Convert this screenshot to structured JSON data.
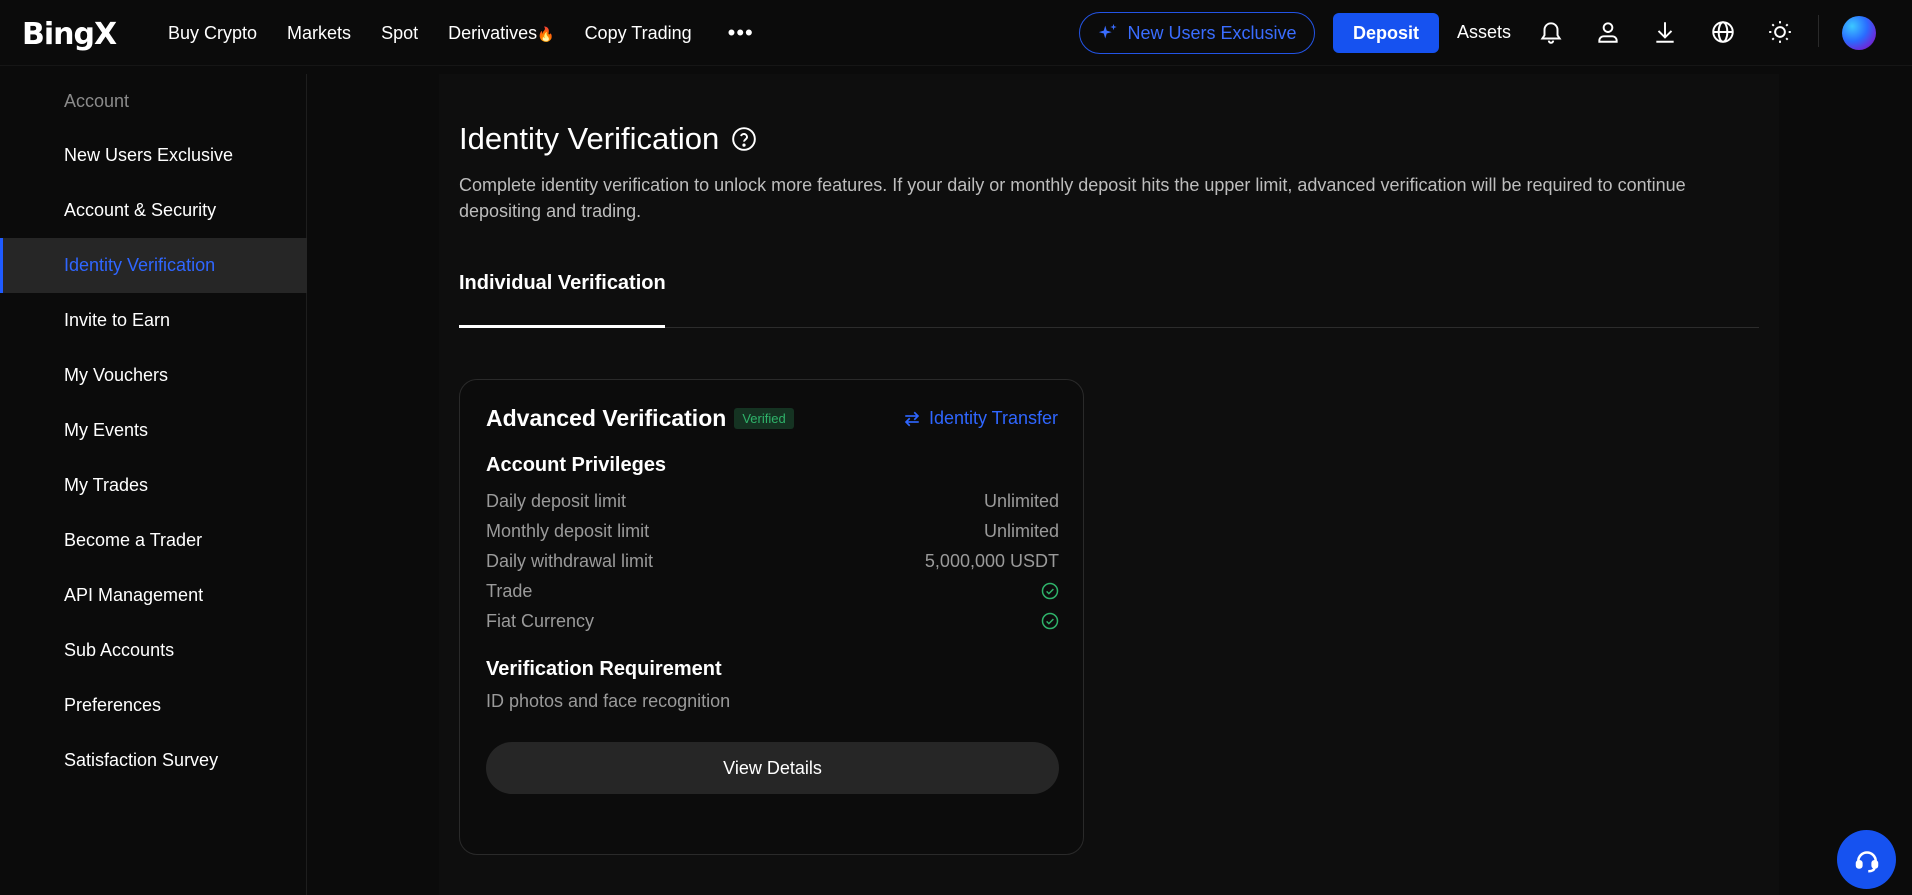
{
  "brand": {
    "logo_text": "BingX"
  },
  "topnav": {
    "items": [
      {
        "label": "Buy Crypto"
      },
      {
        "label": "Markets"
      },
      {
        "label": "Spot"
      },
      {
        "label": "Derivatives"
      },
      {
        "label": "Copy Trading"
      }
    ],
    "derivatives_emoji": "🔥",
    "more_label": "•••",
    "new_users_label": "New Users Exclusive",
    "deposit_label": "Deposit",
    "assets_label": "Assets",
    "icons": [
      "bell-icon",
      "user-icon",
      "download-icon",
      "globe-icon",
      "sun-icon"
    ]
  },
  "sidebar": {
    "heading": "Account",
    "items": [
      {
        "label": "New Users Exclusive"
      },
      {
        "label": "Account & Security"
      },
      {
        "label": "Identity Verification",
        "active": true
      },
      {
        "label": "Invite to Earn"
      },
      {
        "label": "My Vouchers"
      },
      {
        "label": "My Events"
      },
      {
        "label": "My Trades"
      },
      {
        "label": "Become a Trader"
      },
      {
        "label": "API Management"
      },
      {
        "label": "Sub Accounts"
      },
      {
        "label": "Preferences"
      },
      {
        "label": "Satisfaction Survey"
      }
    ]
  },
  "page": {
    "title": "Identity Verification",
    "description": "Complete identity verification to unlock more features. If your daily or monthly deposit hits the upper limit, advanced verification will be required to continue depositing and trading.",
    "tab": "Individual Verification"
  },
  "card": {
    "title": "Advanced Verification",
    "badge": "Verified",
    "transfer_label": "Identity Transfer",
    "privileges_title": "Account Privileges",
    "privileges": [
      {
        "label": "Daily deposit limit",
        "value": "Unlimited"
      },
      {
        "label": "Monthly deposit limit",
        "value": "Unlimited"
      },
      {
        "label": "Daily withdrawal limit",
        "value": "5,000,000 USDT"
      },
      {
        "label": "Trade",
        "value": ""
      },
      {
        "label": "Fiat Currency",
        "value": ""
      }
    ],
    "requirement_title": "Verification Requirement",
    "requirement_text": "ID photos and face recognition",
    "button_label": "View Details"
  },
  "colors": {
    "accent": "#1652f0",
    "link": "#2f66ff",
    "verified": "#2fb36a",
    "background": "#0b0b0b"
  }
}
